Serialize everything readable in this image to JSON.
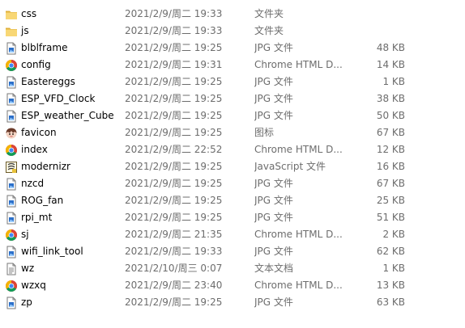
{
  "files": [
    {
      "name": "css",
      "date": "2021/2/9/周二 19:33",
      "type": "文件夹",
      "size": "",
      "icon": "folder-icon"
    },
    {
      "name": "js",
      "date": "2021/2/9/周二 19:33",
      "type": "文件夹",
      "size": "",
      "icon": "folder-icon"
    },
    {
      "name": "blblframe",
      "date": "2021/2/9/周二 19:25",
      "type": "JPG 文件",
      "size": "48 KB",
      "icon": "jpg-file-icon"
    },
    {
      "name": "config",
      "date": "2021/2/9/周二 19:31",
      "type": "Chrome HTML D...",
      "size": "14 KB",
      "icon": "chrome-html-icon"
    },
    {
      "name": "Eastereggs",
      "date": "2021/2/9/周二 19:25",
      "type": "JPG 文件",
      "size": "1 KB",
      "icon": "jpg-file-icon"
    },
    {
      "name": "ESP_VFD_Clock",
      "date": "2021/2/9/周二 19:25",
      "type": "JPG 文件",
      "size": "38 KB",
      "icon": "jpg-file-icon"
    },
    {
      "name": "ESP_weather_Cube",
      "date": "2021/2/9/周二 19:25",
      "type": "JPG 文件",
      "size": "50 KB",
      "icon": "jpg-file-icon"
    },
    {
      "name": "favicon",
      "date": "2021/2/9/周二 19:25",
      "type": "图标",
      "size": "67 KB",
      "icon": "favicon-icon"
    },
    {
      "name": "index",
      "date": "2021/2/9/周二 22:52",
      "type": "Chrome HTML D...",
      "size": "12 KB",
      "icon": "chrome-html-icon"
    },
    {
      "name": "modernizr",
      "date": "2021/2/9/周二 19:25",
      "type": "JavaScript 文件",
      "size": "16 KB",
      "icon": "javascript-file-icon"
    },
    {
      "name": "nzcd",
      "date": "2021/2/9/周二 19:25",
      "type": "JPG 文件",
      "size": "67 KB",
      "icon": "jpg-file-icon"
    },
    {
      "name": "ROG_fan",
      "date": "2021/2/9/周二 19:25",
      "type": "JPG 文件",
      "size": "25 KB",
      "icon": "jpg-file-icon"
    },
    {
      "name": "rpi_mt",
      "date": "2021/2/9/周二 19:25",
      "type": "JPG 文件",
      "size": "51 KB",
      "icon": "jpg-file-icon"
    },
    {
      "name": "sj",
      "date": "2021/2/9/周二 21:35",
      "type": "Chrome HTML D...",
      "size": "2 KB",
      "icon": "chrome-html-icon"
    },
    {
      "name": "wifi_link_tool",
      "date": "2021/2/9/周二 19:33",
      "type": "JPG 文件",
      "size": "62 KB",
      "icon": "jpg-file-icon"
    },
    {
      "name": "wz",
      "date": "2021/2/10/周三 0:07",
      "type": "文本文档",
      "size": "1 KB",
      "icon": "text-file-icon"
    },
    {
      "name": "wzxq",
      "date": "2021/2/9/周二 23:40",
      "type": "Chrome HTML D...",
      "size": "13 KB",
      "icon": "chrome-html-icon"
    },
    {
      "name": "zp",
      "date": "2021/2/9/周二 19:25",
      "type": "JPG 文件",
      "size": "63 KB",
      "icon": "jpg-file-icon"
    }
  ],
  "colors": {
    "folder": "#f8d775",
    "folder_dark": "#e0b03c",
    "jpg_accent": "#2b6fc9",
    "secondary_text": "#6d6d6d"
  }
}
